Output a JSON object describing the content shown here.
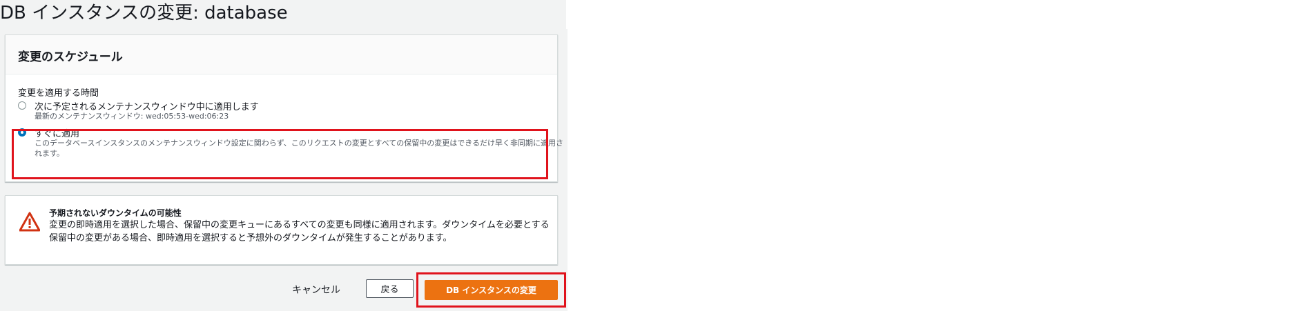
{
  "page": {
    "title": "DB インスタンスの変更: database"
  },
  "schedule": {
    "header": "変更のスケジュール",
    "field_label": "変更を適用する時間",
    "options": [
      {
        "label": "次に予定されるメンテナンスウィンドウ中に適用します",
        "description": "最新のメンテナンスウィンドウ: wed:05:53-wed:06:23",
        "selected": false
      },
      {
        "label": "すぐに適用",
        "description": "このデータベースインスタンスのメンテナンスウィンドウ設定に関わらず、このリクエストの変更とすべての保留中の変更はできるだけ早く非同期に適用されます。",
        "selected": true
      }
    ]
  },
  "warning": {
    "icon": "warning-triangle-icon",
    "title": "予期されないダウンタイムの可能性",
    "text": "変更の即時適用を選択した場合、保留中の変更キューにあるすべての変更も同様に適用されます。ダウンタイムを必要とする保留中の変更がある場合、即時適用を選択すると予想外のダウンタイムが発生することがあります。"
  },
  "actions": {
    "cancel_label": "キャンセル",
    "back_label": "戻る",
    "primary_label": "DB インスタンスの変更"
  },
  "colors": {
    "background": "#f2f3f3",
    "primary_button": "#ec7211",
    "radio_selected": "#0073bb",
    "warning_icon": "#d13212",
    "highlight_border": "#e0131c"
  }
}
